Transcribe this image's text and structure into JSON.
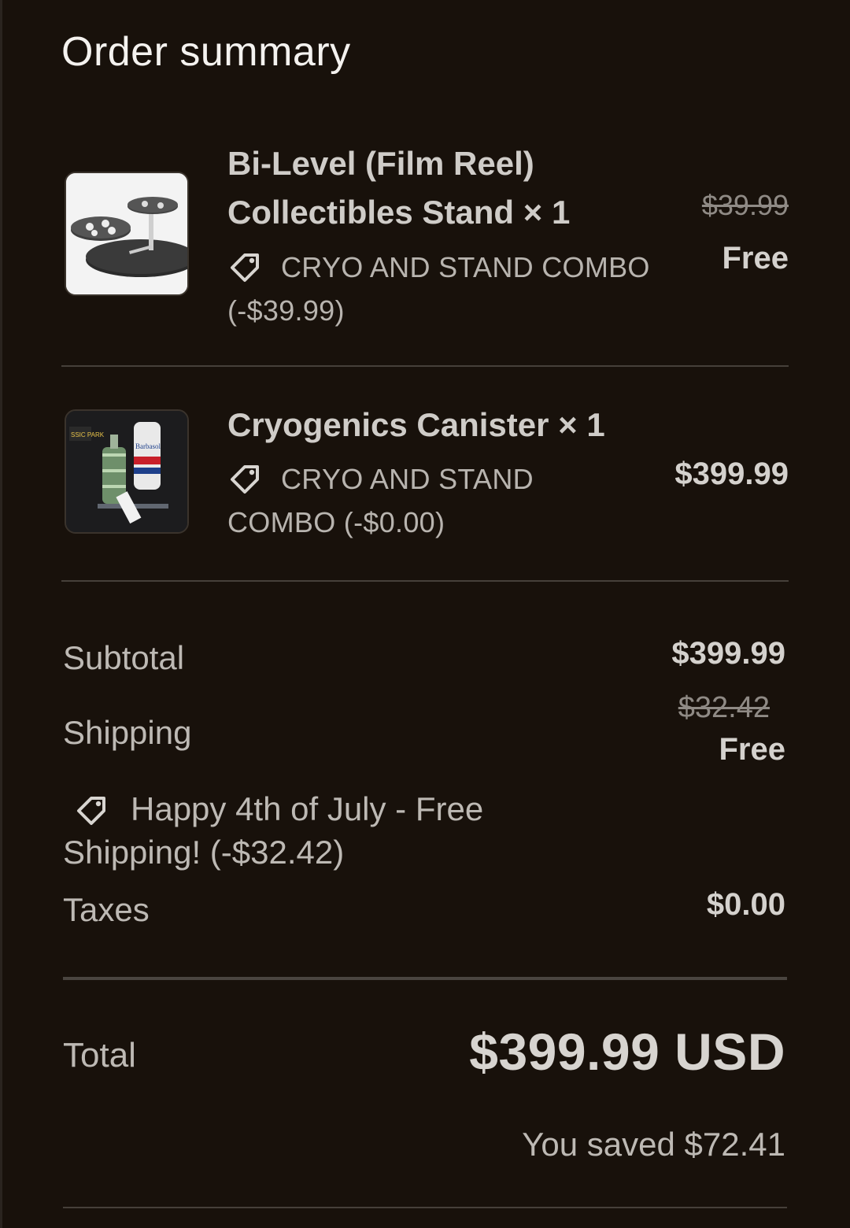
{
  "header": {
    "title": "Order summary"
  },
  "items": [
    {
      "name_line1": "Bi-Level (Film Reel)",
      "name_line2": "Collectibles Stand × 1",
      "discount_line1": "CRYO AND STAND COMBO",
      "discount_line2": "(-$39.99)",
      "original_price": "$39.99",
      "price": "Free",
      "thumb_icon": "film-reel-stand-image"
    },
    {
      "name_line1": "Cryogenics Canister × 1",
      "discount_line1": "CRYO AND STAND",
      "discount_line2": "COMBO (-$0.00)",
      "price": "$399.99",
      "thumb_icon": "cryogenics-canister-image",
      "thumb_text_1": "SSIC PARK",
      "thumb_text_2": "Barbasol"
    }
  ],
  "summary": {
    "subtotal_label": "Subtotal",
    "subtotal_value": "$399.99",
    "shipping_label": "Shipping",
    "shipping_original": "$32.42",
    "shipping_value": "Free",
    "shipping_discount_line1": "Happy 4th of July - Free",
    "shipping_discount_line2": "Shipping! (-$32.42)",
    "taxes_label": "Taxes",
    "taxes_value": "$0.00",
    "total_label": "Total",
    "total_value": "$399.99 USD",
    "saved_text": "You saved $72.41"
  },
  "colors": {
    "background": "#18110b",
    "text": "#d4d1cd",
    "muted": "#8f8a85"
  }
}
